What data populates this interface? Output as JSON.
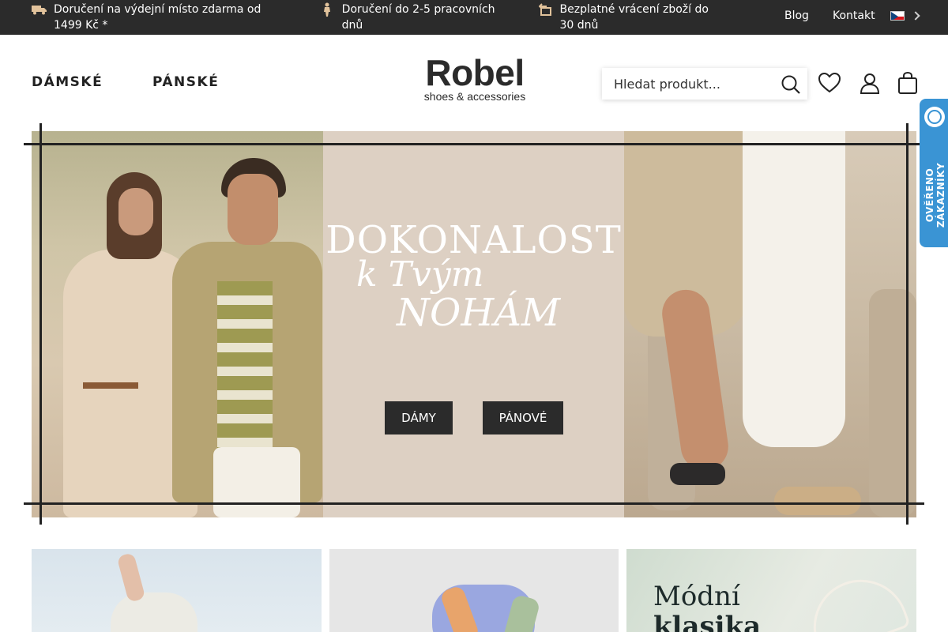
{
  "topbar": {
    "usp": [
      {
        "icon": "truck-icon",
        "text": "Doručení na výdejní místo zdarma od 1499 Kč *"
      },
      {
        "icon": "delivery-person-icon",
        "text": "Doručení do 2-5 pracovních dnů"
      },
      {
        "icon": "return-box-icon",
        "text": "Bezplatné vrácení zboží do 30 dnů"
      }
    ],
    "links": {
      "blog": "Blog",
      "contact": "Kontakt"
    },
    "language": "cs"
  },
  "header": {
    "nav": {
      "women": "DÁMSKÉ",
      "men": "PÁNSKÉ"
    },
    "logo": {
      "word": "Robel",
      "tagline": "shoes & accessories"
    },
    "search": {
      "placeholder": "Hledat produkt..."
    },
    "icons": [
      "search-icon",
      "heart-icon",
      "user-icon",
      "cart-icon"
    ]
  },
  "hero": {
    "line1": "DOKONALOST",
    "line2": "k Tvým",
    "line3": "NOHÁM",
    "buttons": {
      "women": "DÁMY",
      "men": "PÁNOVÉ"
    }
  },
  "badge": {
    "text": "OVĚŘENO ZÁKAZNÍKY",
    "color": "#3a94d4"
  },
  "tiles": [
    {
      "title_line1": "",
      "title_line2": ""
    },
    {
      "title_line1": "",
      "title_line2": ""
    },
    {
      "title_line1": "Módní",
      "title_line2": "klasika"
    }
  ],
  "colors": {
    "topbar": "#2b2b2b",
    "button": "#2b2b2b",
    "accent": "#e2c39c"
  }
}
